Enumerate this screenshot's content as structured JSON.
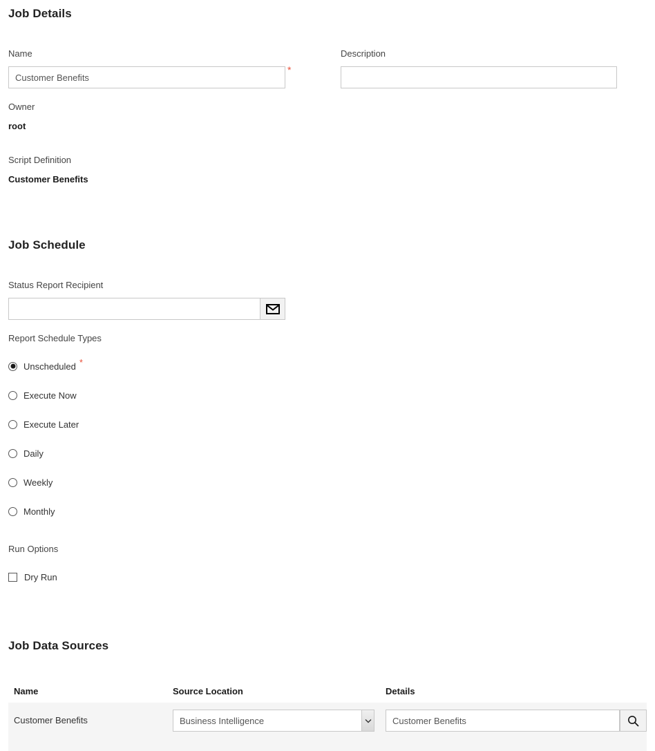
{
  "sections": {
    "job_details": {
      "heading": "Job Details",
      "name_label": "Name",
      "name_value": "Customer Benefits",
      "name_placeholder": "",
      "required_marker": "*",
      "description_label": "Description",
      "description_value": "",
      "description_placeholder": "",
      "owner_label": "Owner",
      "owner_value": "root",
      "script_definition_label": "Script Definition",
      "script_definition_value": "Customer Benefits"
    },
    "job_schedule": {
      "heading": "Job Schedule",
      "recipient_label": "Status Report Recipient",
      "recipient_value": "",
      "recipient_placeholder": "",
      "recipient_button_icon": "envelope-icon",
      "schedule_types_label": "Report Schedule Types",
      "required_marker": "*",
      "schedule_types": [
        {
          "label": "Unscheduled",
          "selected": true,
          "required": true
        },
        {
          "label": "Execute Now",
          "selected": false,
          "required": false
        },
        {
          "label": "Execute Later",
          "selected": false,
          "required": false
        },
        {
          "label": "Daily",
          "selected": false,
          "required": false
        },
        {
          "label": "Weekly",
          "selected": false,
          "required": false
        },
        {
          "label": "Monthly",
          "selected": false,
          "required": false
        }
      ],
      "run_options_label": "Run Options",
      "dry_run_label": "Dry Run",
      "dry_run_checked": false
    },
    "job_data_sources": {
      "heading": "Job Data Sources",
      "columns": [
        "Name",
        "Source Location",
        "Details"
      ],
      "rows": [
        {
          "name": "Customer Benefits",
          "source_location_selected": "Business Intelligence",
          "source_location_options": [
            "Business Intelligence"
          ],
          "details_value": "Customer Benefits",
          "details_placeholder": "",
          "details_button_icon": "search-icon"
        }
      ]
    }
  },
  "colors": {
    "page_background": "#ffffff",
    "heading_text": "#222222",
    "label_text": "#444444",
    "value_text": "#1a1a1a",
    "input_border": "#c8c8c8",
    "required_star": "#e8503a",
    "row_band": "#f5f5f5",
    "button_face": "#f2f2f2"
  }
}
